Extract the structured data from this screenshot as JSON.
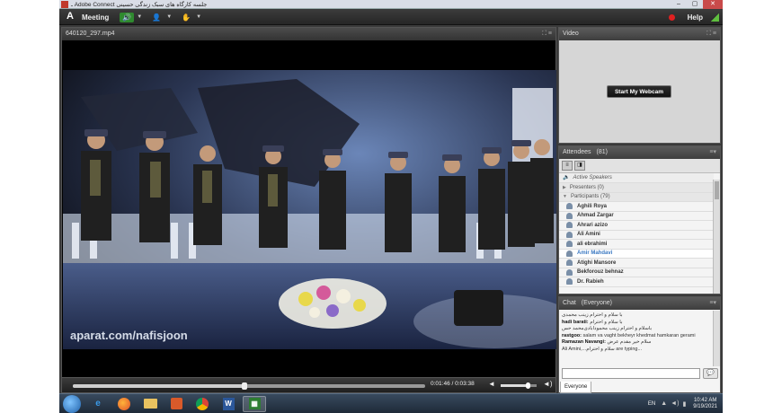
{
  "window": {
    "title": "ـ Adobe Connect جلسه کارگاه های سبک زندگی حسینی",
    "minimize": "–",
    "maximize": "▢",
    "close": "✕"
  },
  "menubar": {
    "logo": "A",
    "meeting": "Meeting",
    "audio_icon": "speaker-icon",
    "camera_icon": "person-icon",
    "raise_icon": "hand-icon",
    "help": "Help"
  },
  "share_pod": {
    "title": "640120_297.mp4",
    "watermark": "aparat.com/nafisjoon",
    "time": "0:01:46 / 0:03:38",
    "progress": 0.486,
    "volume": 0.75
  },
  "video_pod": {
    "title": "Video",
    "webcam_button": "Start My Webcam"
  },
  "attendees": {
    "title": "Attendees",
    "count": "(81)",
    "active_speakers": "Active Speakers",
    "presenters": "Presenters (0)",
    "participants": "Participants (79)",
    "names": [
      "Aghili Roya",
      "Ahmad Zargar",
      "Ahrari azizo",
      "Ali Amini",
      "ali ebrahimi",
      "Amir Mahdavi",
      "Atighi Mansore",
      "Bekforouz behnaz",
      "Dr. Rabieh"
    ],
    "selected_index": 5
  },
  "chat": {
    "title": "Chat",
    "scope": "(Everyone)",
    "messages": [
      {
        "sender": "",
        "text": "با سلام و احترام زینب محمدی"
      },
      {
        "sender": "hadi barati:",
        "text": " با سلام و احترام"
      },
      {
        "sender": "",
        "text": "باسلام و احترام زینب محمودآبادی‌محمد حس"
      },
      {
        "sender": "rastgoo:",
        "text": " salam va vaght bekheyr khedmat hamkaran gerami"
      },
      {
        "sender": "Ramazan Navangi:",
        "text": " سلام خیر مقدم عرض"
      },
      {
        "sender": "",
        "text": "Ali Amini,...سلام و احترام are typing..."
      }
    ],
    "send_icon": "speech-bubble-icon",
    "tab": "Everyone"
  },
  "taskbar": {
    "apps": [
      "ie-icon",
      "firefox-icon",
      "file-explorer-icon",
      "media-player-icon",
      "chrome-icon",
      "word-icon",
      "adobe-connect-icon"
    ],
    "lang": "EN",
    "time": "10:42 AM",
    "date": "9/19/2021"
  },
  "colors": {
    "menubar": "#2e2e2e",
    "accent": "#3a78c2",
    "record": "#e02020"
  }
}
